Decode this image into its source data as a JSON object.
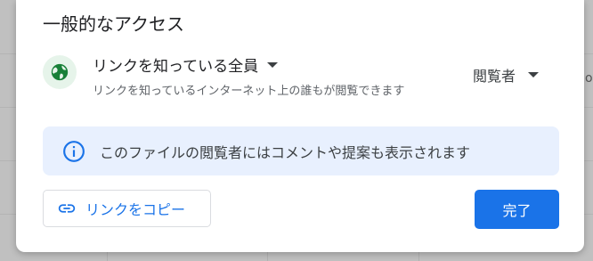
{
  "general_access": {
    "section_title": "一般的なアクセス",
    "link_setting": "リンクを知っている全員",
    "link_setting_description": "リンクを知っているインターネット上の誰もが閲覧できます",
    "role": "閲覧者",
    "globe_icon": "globe-icon"
  },
  "info_banner": {
    "text": "このファイルの閲覧者にはコメントや提案も表示されます",
    "icon": "info-icon"
  },
  "actions": {
    "copy_link_label": "リンクをコピー",
    "copy_link_icon": "link-icon",
    "done_label": "完了"
  },
  "background": {
    "side_letter": "o"
  },
  "colors": {
    "accent": "#1a73e8",
    "globe_bg": "#e6f4ea",
    "globe": "#188038",
    "banner_bg": "#e8f0fe",
    "text_primary": "#202124",
    "text_secondary": "#5f6368"
  }
}
